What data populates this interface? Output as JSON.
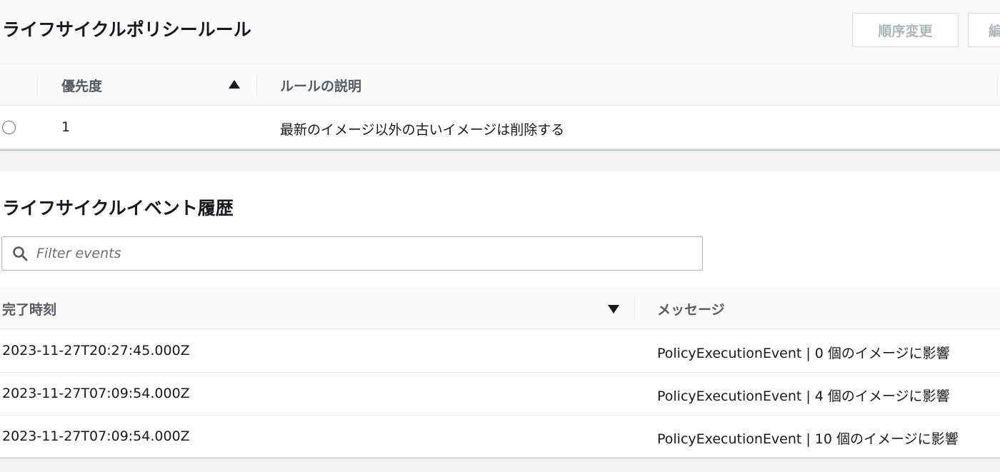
{
  "rules": {
    "title": "ライフサイクルポリシールール",
    "buttons": {
      "reorder": "順序変更",
      "edit": "編集"
    },
    "columns": {
      "priority": "優先度",
      "description": "ルールの説明"
    },
    "rows": [
      {
        "priority": "1",
        "description": "最新のイメージ以外の古いイメージは削除する"
      }
    ]
  },
  "events": {
    "title": "ライフサイクルイベント履歴",
    "filter": {
      "placeholder": "Filter events",
      "value": ""
    },
    "columns": {
      "completed_time": "完了時刻",
      "message": "メッセージ"
    },
    "rows": [
      {
        "completed_time": "2023-11-27T20:27:45.000Z",
        "message": "PolicyExecutionEvent | 0 個のイメージに影響"
      },
      {
        "completed_time": "2023-11-27T07:09:54.000Z",
        "message": "PolicyExecutionEvent | 4 個のイメージに影響"
      },
      {
        "completed_time": "2023-11-27T07:09:54.000Z",
        "message": "PolicyExecutionEvent | 10 個のイメージに影響"
      }
    ]
  },
  "icons": {
    "search": "search-icon",
    "sort_ascending": "sort-ascending-icon",
    "sort_descending": "sort-descending-icon",
    "radio": "radio-icon"
  },
  "colors": {
    "header_bg": "#fafafa",
    "text": "#16191f",
    "muted": "#545b64",
    "disabled_button": "#aab7b8",
    "border": "#eaeded",
    "page_bg": "#f2f3f3"
  }
}
